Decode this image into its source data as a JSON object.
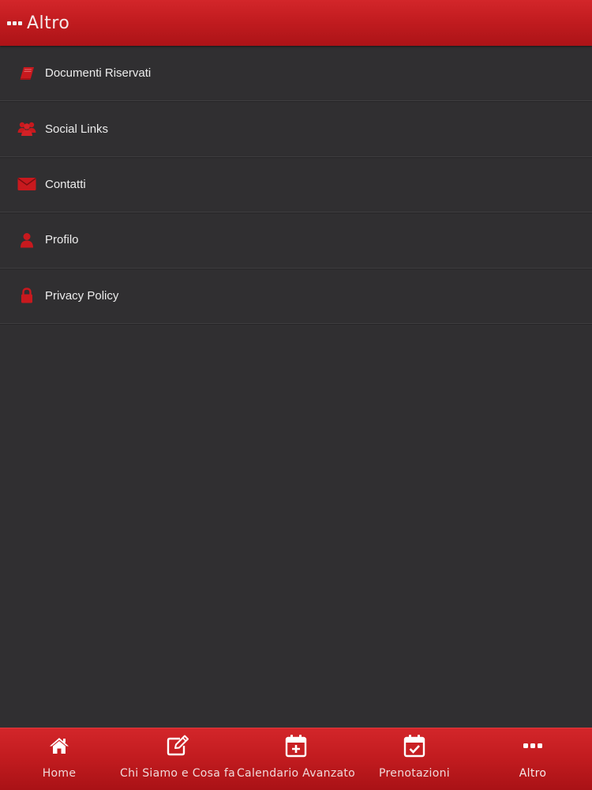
{
  "header": {
    "title": "Altro",
    "icon": "more-dots-icon"
  },
  "menu": {
    "items": [
      {
        "label": "Documenti Riservati",
        "icon": "book-icon"
      },
      {
        "label": "Social Links",
        "icon": "users-icon"
      },
      {
        "label": "Contatti",
        "icon": "envelope-icon"
      },
      {
        "label": "Profilo",
        "icon": "user-icon"
      },
      {
        "label": "Privacy Policy",
        "icon": "lock-icon"
      }
    ]
  },
  "tabbar": {
    "tabs": [
      {
        "label": "Home",
        "icon": "home-icon"
      },
      {
        "label": "Chi Siamo e Cosa fa",
        "icon": "edit-icon"
      },
      {
        "label": "Calendario Avanzato",
        "icon": "calendar-plus-icon"
      },
      {
        "label": "Prenotazioni",
        "icon": "calendar-check-icon"
      },
      {
        "label": "Altro",
        "icon": "more-dots-icon",
        "active": true
      }
    ]
  },
  "colors": {
    "accent": "#c21c20",
    "background": "#302f31",
    "icon_red": "#c8191e"
  }
}
